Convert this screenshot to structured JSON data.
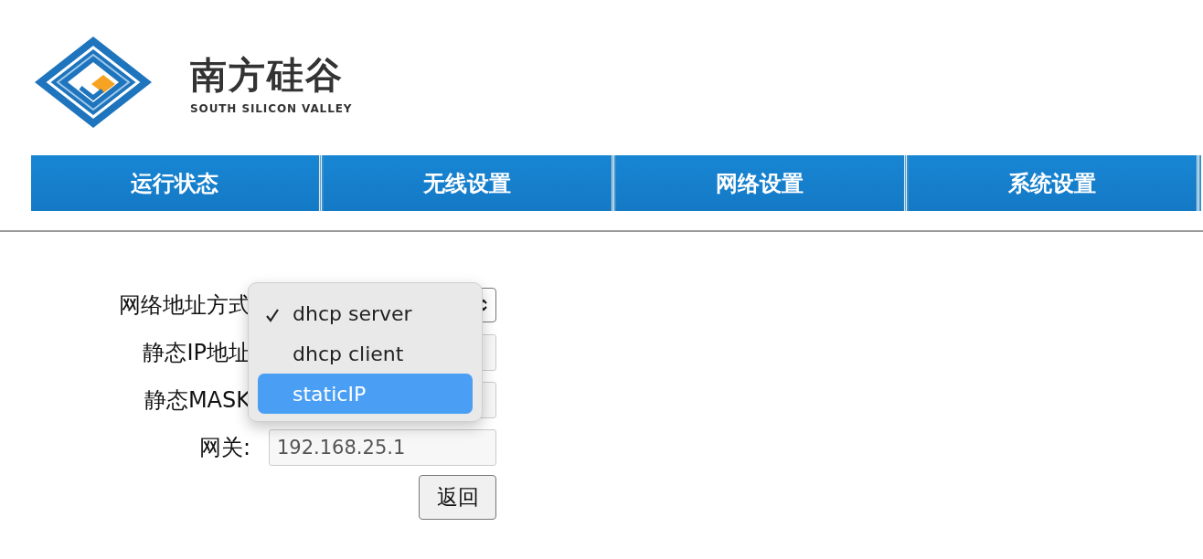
{
  "logo": {
    "name": "南方硅谷",
    "subtitle": "SOUTH SILICON VALLEY"
  },
  "nav": {
    "tabs": [
      {
        "label": "运行状态"
      },
      {
        "label": "无线设置"
      },
      {
        "label": "网络设置"
      },
      {
        "label": "系统设置"
      }
    ]
  },
  "form": {
    "fields": [
      {
        "kind": "select",
        "label": "网络地址方式"
      },
      {
        "kind": "input",
        "label": "静态IP地址"
      },
      {
        "kind": "input",
        "label": "静态MASK"
      },
      {
        "kind": "input",
        "label": "网关:",
        "value": "192.168.25.1"
      }
    ],
    "button": "返回"
  },
  "dropdown": {
    "options": [
      {
        "label": "dhcp server",
        "checked": true,
        "selected": false
      },
      {
        "label": "dhcp client",
        "checked": false,
        "selected": false
      },
      {
        "label": "staticIP",
        "checked": false,
        "selected": true
      }
    ]
  }
}
